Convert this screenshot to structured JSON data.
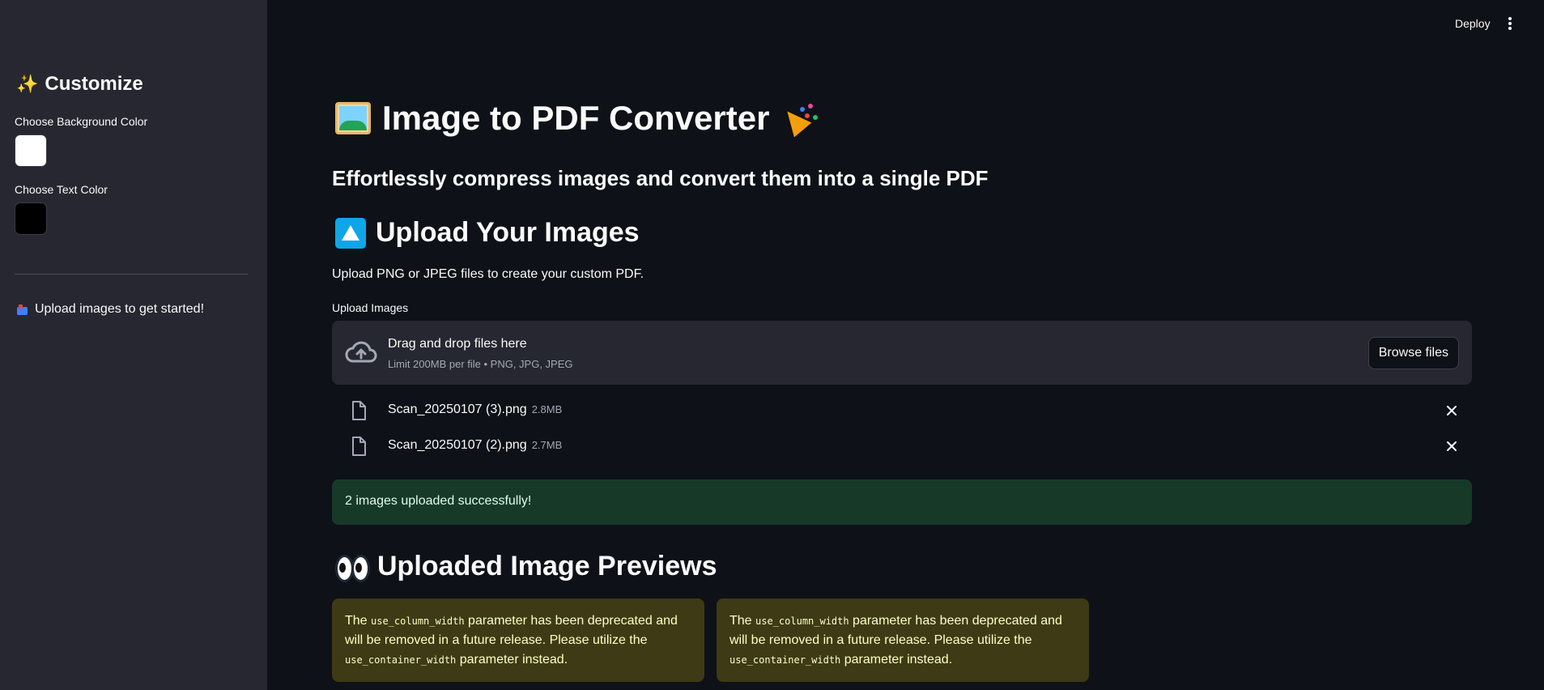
{
  "header": {
    "deploy_label": "Deploy",
    "menu_icon": "kebab-menu-icon"
  },
  "sidebar": {
    "title": "Customize",
    "title_icon": "sparkles-icon",
    "bg_color_label": "Choose Background Color",
    "bg_color_value": "#ffffff",
    "text_color_label": "Choose Text Color",
    "text_color_value": "#000000",
    "info_icon": "mailbox-icon",
    "info_text": "Upload images to get started!"
  },
  "main": {
    "title": "Image to PDF Converter",
    "subtitle": "Effortlessly compress images and convert them into a single PDF",
    "upload_heading": "Upload Your Images",
    "upload_description": "Upload PNG or JPEG files to create your custom PDF.",
    "uploader": {
      "label": "Upload Images",
      "drop_title": "Drag and drop files here",
      "limit_text": "Limit 200MB per file • PNG, JPG, JPEG",
      "browse_label": "Browse files"
    },
    "files": [
      {
        "name": "Scan_20250107 (3).png",
        "size": "2.8MB"
      },
      {
        "name": "Scan_20250107 (2).png",
        "size": "2.7MB"
      }
    ],
    "success_message": "2 images uploaded successfully!",
    "previews_heading": "Uploaded Image Previews",
    "warnings": [
      {
        "prefix": "The ",
        "code1": "use_column_width",
        "middle": " parameter has been deprecated and will be removed in a future release. Please utilize the ",
        "code2": "use_container_width",
        "suffix": " parameter instead."
      },
      {
        "prefix": "The ",
        "code1": "use_column_width",
        "middle": " parameter has been deprecated and will be removed in a future release. Please utilize the ",
        "code2": "use_container_width",
        "suffix": " parameter instead."
      }
    ]
  },
  "colors": {
    "app_bg": "#0e1117",
    "sidebar_bg": "#262730",
    "success_bg": "#173928",
    "warning_bg": "#3d3a15"
  }
}
